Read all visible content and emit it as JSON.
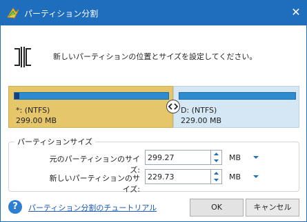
{
  "window": {
    "title": "パーティション分割",
    "close_glyph": "✕"
  },
  "instruction": "新しいパーティションの位置とサイズを設定してください。",
  "partitions": {
    "left": {
      "name": "*: (NTFS)",
      "size": "299.00 MB",
      "used_fraction": 0.03,
      "color": "#e6c66a"
    },
    "right": {
      "name": "D: (NTFS)",
      "size": "229.00 MB",
      "used_fraction": 0.0,
      "color": "#d5e7f4"
    }
  },
  "sizes_group": {
    "title": "パーティションサイズ",
    "original_label": "元のパーティションのサイズ:",
    "original_value": "299.27",
    "original_unit": "MB",
    "new_label": "新しいパーティションのサイズ:",
    "new_value": "229.73",
    "new_unit": "MB"
  },
  "footer": {
    "help_glyph": "?",
    "help_link": "パーティション分割のチュートリアル",
    "ok_label": "OK",
    "cancel_label": "キャンセル"
  },
  "colors": {
    "accent": "#1f6dbd",
    "bar": "#2d8bd0",
    "link": "#1a57b8"
  }
}
